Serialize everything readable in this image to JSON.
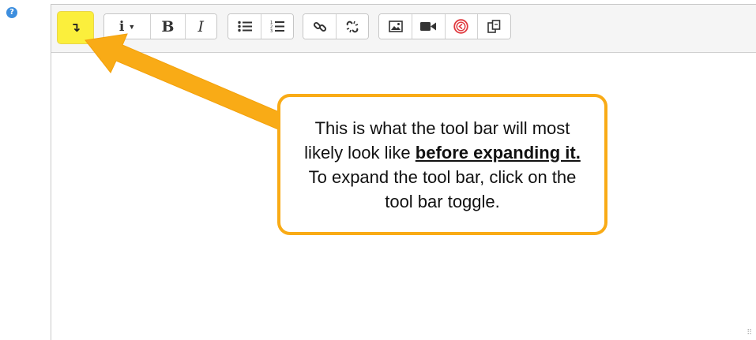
{
  "help": {
    "icon": "question-circle-icon",
    "glyph": "?"
  },
  "toolbar": {
    "toggle_glyph": "↴",
    "info_glyph": "i",
    "bold_glyph": "B",
    "italic_glyph": "I"
  },
  "callout": {
    "text_before": "This is what the tool bar will most likely look like ",
    "emphasis": "before expanding it.",
    "text_after": " To expand the tool bar, click on the tool bar toggle."
  },
  "colors": {
    "highlight_yellow": "#fbef3c",
    "callout_orange": "#f9ab16",
    "help_blue": "#3d8ede",
    "video_red": "#e0393e"
  }
}
